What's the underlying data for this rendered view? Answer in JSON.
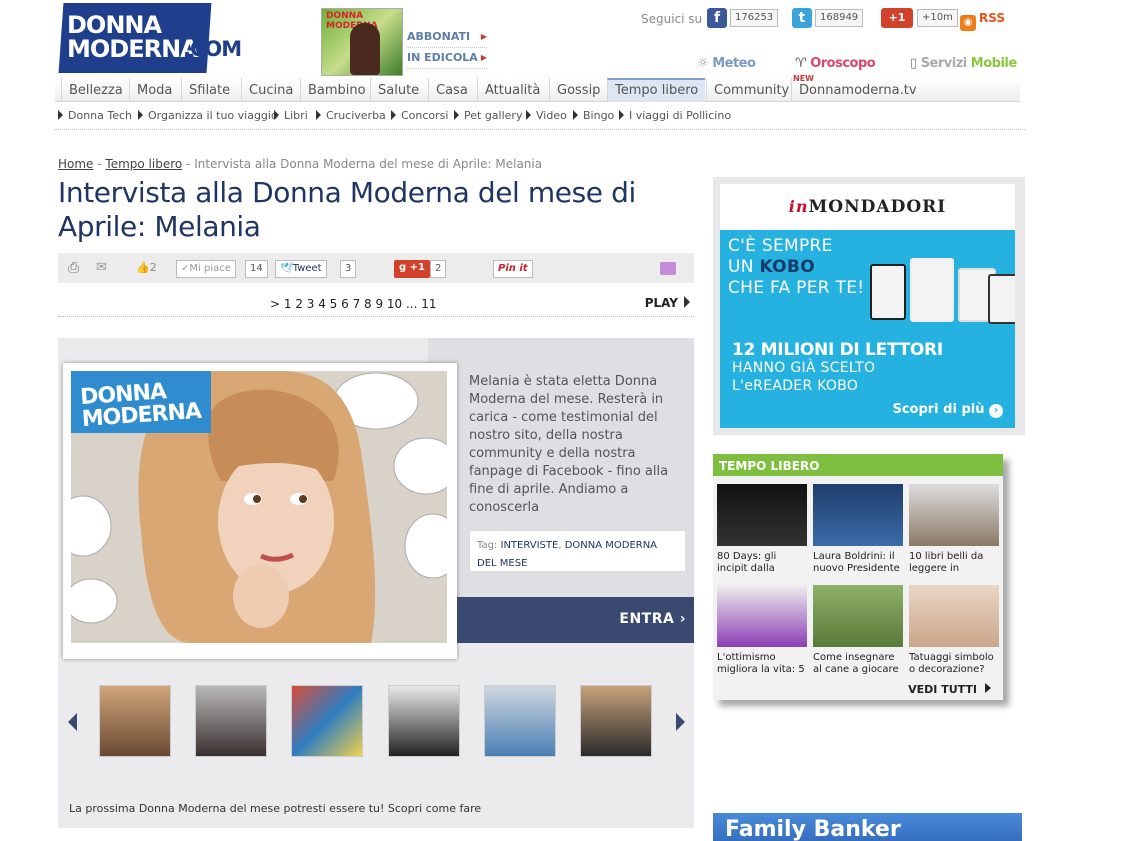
{
  "header": {
    "logo_line1": "DONNA",
    "logo_line2": "MODERNA",
    "logo_com": ".COM",
    "magazine_title": "DONNA MODERNA",
    "abbonati": "ABBONATI",
    "in_edicola": "IN EDICOLA",
    "seguici": "Seguici su",
    "facebook_count": "176253",
    "twitter_count": "168949",
    "gplus_label": "+1",
    "gplus_count": "+10m",
    "rss": "RSS",
    "meteo": "Meteo",
    "oroscopo": "Oroscopo",
    "servizi": "Servizi",
    "mobile": "Mobile"
  },
  "main_nav": {
    "items": [
      "Bellezza",
      "Moda",
      "Sfilate",
      "Cucina",
      "Bambino",
      "Salute",
      "Casa",
      "Attualità",
      "Gossip",
      "Tempo libero",
      "Community",
      "Donnamoderna.tv"
    ],
    "active": "Tempo libero",
    "new_badge": "NEW"
  },
  "sub_nav": {
    "items": [
      "Donna Tech",
      "Organizza il tuo viaggio",
      "Libri",
      "Cruciverba",
      "Concorsi",
      "Pet gallery",
      "Video",
      "Bingo",
      "I viaggi di Pollicino"
    ]
  },
  "breadcrumb": {
    "home": "Home",
    "section": "Tempo libero",
    "current": "Intervista alla Donna Moderna del mese di Aprile: Melania"
  },
  "article": {
    "title": "Intervista alla Donna Moderna del mese di Aprile: Melania",
    "likes_count": "2",
    "mi_piace": "Mi piace",
    "mi_piace_count": "14",
    "tweet": "Tweet",
    "tweet_count": "3",
    "gplus": "+1",
    "gplus_count": "2",
    "pinit": "Pin it",
    "pager": "> 1 2 3 4 5 6 7 8 9 10 ... 11",
    "play": "PLAY",
    "description": "Melania è stata eletta Donna Moderna del mese. Resterà in carica - come testimonial del nostro sito, della nostra community e della nostra fanpage di Facebook - fino alla fine di aprile. Andiamo a conoscerla",
    "tags_label": "Tag:",
    "tags": [
      "INTERVISTE",
      "DONNA MODERNA DEL MESE"
    ],
    "entra": "ENTRA",
    "photo_logo1": "DONNA",
    "photo_logo2": "MODERNA",
    "promo": "La prossima Donna Moderna del mese potresti essere tu! Scopri come fare"
  },
  "ad_mondadori": {
    "brand_prefix": "in",
    "brand": "MONDADORI",
    "line1": "C'È SEMPRE",
    "line2a": "UN ",
    "line2b": "KOBO",
    "line3": "CHE FA PER TE!",
    "headline": "12 MILIONI DI LETTORI",
    "sub1": "HANNO GIÀ SCELTO",
    "sub2": "L'eREADER KOBO",
    "cta": "Scopri di più"
  },
  "tempo_libero": {
    "title": "TEMPO LIBERO",
    "items": [
      {
        "caption": "80 Days: gli incipit dalla nuova"
      },
      {
        "caption": "Laura Boldrini: il nuovo Presidente"
      },
      {
        "caption": "10 libri belli da leggere in"
      },
      {
        "caption": "L'ottimismo migliora la vita: 5"
      },
      {
        "caption": "Come insegnare al cane a giocare"
      },
      {
        "caption": "Tatuaggi simbolo o decorazione?"
      }
    ],
    "vedi_tutti": "VEDI TUTTI"
  },
  "family_banker": {
    "label": "Family Banker"
  },
  "colors": {
    "brand_blue": "#1f3f8c",
    "title_blue": "#1f3563",
    "green": "#7fbf3f",
    "kobo_blue": "#26b2e0"
  }
}
